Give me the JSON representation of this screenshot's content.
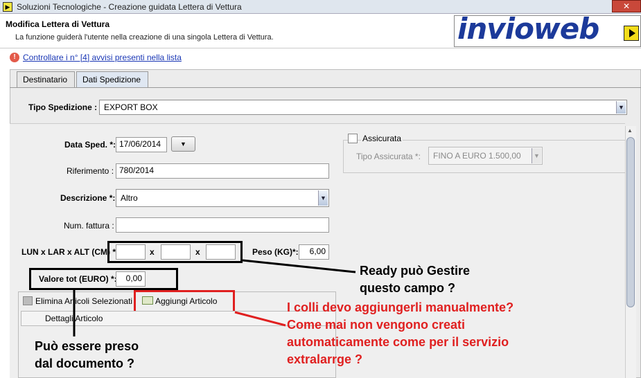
{
  "window": {
    "title": "Soluzioni Tecnologiche - Creazione guidata Lettera di Vettura",
    "close_label": "✕"
  },
  "header": {
    "title": "Modifica Lettera di Vettura",
    "subtitle": "La funzione guiderà l'utente nella creazione di una singola Lettera di Vettura.",
    "logo_text": "invioweb"
  },
  "warning": {
    "icon": "!",
    "link": "Controllare i n° [4] avvisi presenti nella lista"
  },
  "tabs": [
    {
      "label": "Destinatario"
    },
    {
      "label": "Dati Spedizione"
    }
  ],
  "form": {
    "tipo_spedizione_label": "Tipo Spedizione :",
    "tipo_spedizione_value": "EXPORT BOX",
    "data_sped_label": "Data Sped. *:",
    "data_sped_value": "17/06/2014",
    "riferimento_label": "Riferimento :",
    "riferimento_value": "780/2014",
    "descrizione_label": "Descrizione *:",
    "descrizione_value": "Altro",
    "num_fattura_label": "Num. fattura :",
    "num_fattura_value": "",
    "dimensioni_label": "LUN x LAR x ALT (CM) *:",
    "x1": "x",
    "x2": "x",
    "peso_label": "Peso (KG)*:",
    "peso_value": "6,00",
    "valore_label": "Valore tot (EURO) *:",
    "valore_value": "0,00",
    "assicurata_label": "Assicurata",
    "tipo_assicurata_label": "Tipo Assicurata *:",
    "tipo_assicurata_value": "FINO A EURO 1.500,00"
  },
  "articoli": {
    "elimina_label": "Elimina Articoli Selezionati",
    "aggiungi_label": "Aggiungi Articolo",
    "column_header": "Dettagli Articolo"
  },
  "annotations": {
    "ready_line1": "Ready può Gestire",
    "ready_line2": "questo campo ?",
    "colli_line1": "I colli devo aggiungerli manualmente?",
    "colli_line2": "Come mai non vengono creati",
    "colli_line3": "automaticamente come per il servizio",
    "colli_line4": "extralarrge ?",
    "doc_line1": "Può essere preso",
    "doc_line2": "dal documento ?",
    "black_color": "#000000",
    "red_color": "#e02020"
  }
}
